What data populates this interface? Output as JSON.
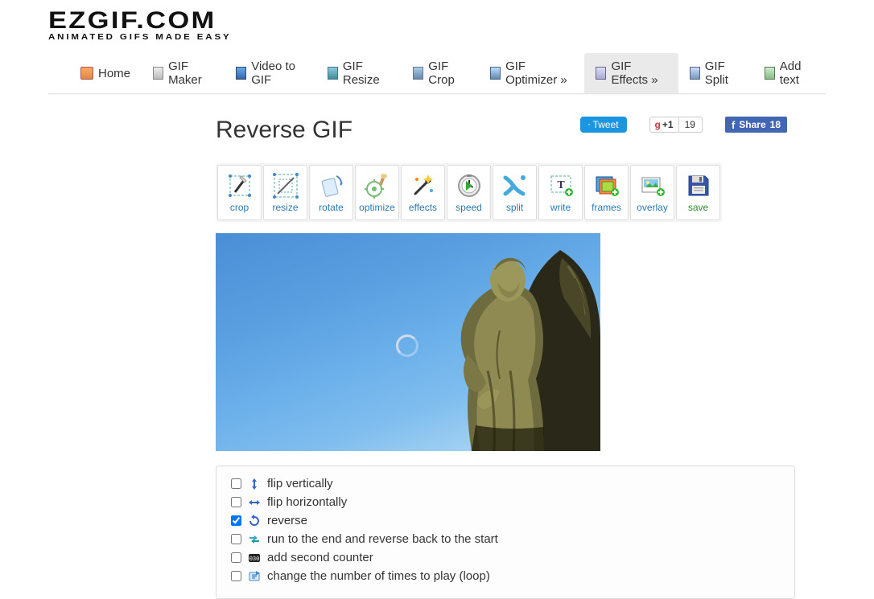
{
  "logo": {
    "title": "EZGIF.COM",
    "subtitle": "ANIMATED GIFS MADE EASY"
  },
  "nav": [
    {
      "label": "Home"
    },
    {
      "label": "GIF Maker"
    },
    {
      "label": "Video to GIF"
    },
    {
      "label": "GIF Resize"
    },
    {
      "label": "GIF Crop"
    },
    {
      "label": "GIF Optimizer »"
    },
    {
      "label": "GIF Effects »"
    },
    {
      "label": "GIF Split"
    },
    {
      "label": "Add text"
    }
  ],
  "social": {
    "tweet": "Tweet",
    "gplus_label": "+1",
    "gplus_count": "19",
    "fb_label": "Share",
    "fb_count": "18"
  },
  "page_title": "Reverse GIF",
  "tools": [
    {
      "label": "crop"
    },
    {
      "label": "resize"
    },
    {
      "label": "rotate"
    },
    {
      "label": "optimize"
    },
    {
      "label": "effects"
    },
    {
      "label": "speed"
    },
    {
      "label": "split"
    },
    {
      "label": "write"
    },
    {
      "label": "frames"
    },
    {
      "label": "overlay"
    },
    {
      "label": "save"
    }
  ],
  "options": [
    {
      "label": "flip vertically",
      "checked": false
    },
    {
      "label": "flip horizontally",
      "checked": false
    },
    {
      "label": "reverse",
      "checked": true
    },
    {
      "label": "run to the end and reverse back to the start",
      "checked": false
    },
    {
      "label": "add second counter",
      "checked": false
    },
    {
      "label": "change the number of times to play (loop)",
      "checked": false
    }
  ]
}
